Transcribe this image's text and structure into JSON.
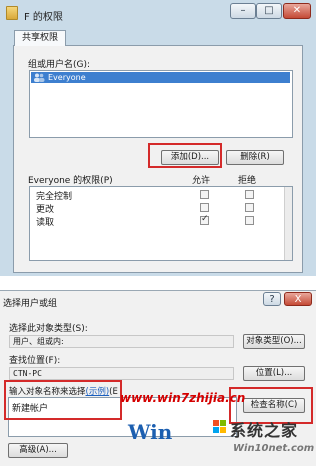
{
  "top_dialog": {
    "title": "F 的权限",
    "tab": "共享权限",
    "groups_label": "组或用户名(G):",
    "selected_user": "Everyone",
    "add_button": "添加(D)...",
    "remove_button": "删除(R)",
    "permissions_header": "Everyone 的权限(P)",
    "allow_header": "允许",
    "deny_header": "拒绝",
    "permissions": [
      {
        "name": "完全控制",
        "allow": false,
        "deny": false
      },
      {
        "name": "更改",
        "allow": false,
        "deny": false
      },
      {
        "name": "读取",
        "allow": true,
        "deny": false
      }
    ]
  },
  "bottom_dialog": {
    "title": "选择用户或组",
    "help_button": "?",
    "close_button": "X",
    "select_object_type_label": "选择此对象类型(S):",
    "object_type_value": "用户、组或内:",
    "object_type_button": "对象类型(O)...",
    "location_label": "查找位置(F):",
    "location_value": "CTN-PC",
    "location_button": "位置(L)...",
    "enter_names_label": "输入对象名称来选择",
    "example_link": "(示例)",
    "enter_names_suffix": "(E",
    "input_value": "新建帐户",
    "check_names_button": "检查名称(C)",
    "advanced_button": "高级(A)..."
  },
  "watermark": {
    "url": "www.win7zhijia.cn",
    "logo": "Win",
    "site_name": "系统之家",
    "site_domain": "Win10net.com"
  },
  "colors": {
    "selection_blue": "#3d7fcf",
    "highlight_red": "#d42a2a",
    "title_bar": "#c9dbe8"
  }
}
